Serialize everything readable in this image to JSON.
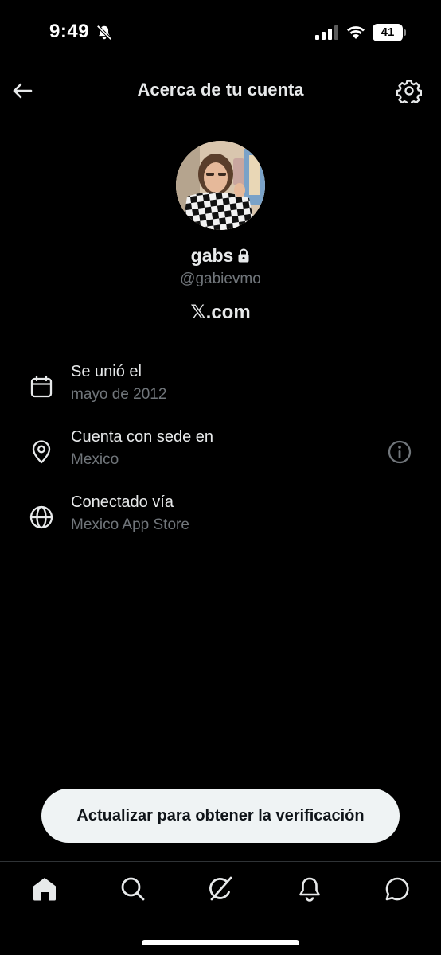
{
  "status_bar": {
    "time": "9:49",
    "battery_level": "41",
    "icons": [
      "bell-muted-icon",
      "signal-icon",
      "wifi-icon",
      "battery-icon"
    ]
  },
  "header": {
    "title": "Acerca de tu cuenta",
    "back_icon": "arrow-left-icon",
    "settings_icon": "gear-icon"
  },
  "profile": {
    "name": "gabs",
    "protected_icon": "lock-icon",
    "handle": "@gabievmo",
    "site": "𝕏.com"
  },
  "info_rows": [
    {
      "icon": "calendar-icon",
      "label": "Se unió el",
      "value": "mayo de 2012"
    },
    {
      "icon": "location-pin-icon",
      "label": "Cuenta con sede en",
      "value": "Mexico",
      "action_icon": "info-icon"
    },
    {
      "icon": "globe-icon",
      "label": "Conectado vía",
      "value": "Mexico App Store"
    }
  ],
  "cta": {
    "label": "Actualizar para obtener la verificación"
  },
  "bottom_nav": {
    "items": [
      "home-icon",
      "search-icon",
      "grok-icon",
      "notifications-icon",
      "messages-icon"
    ],
    "active": "home-icon"
  },
  "colors": {
    "background": "#000000",
    "primary_text": "#e7e9ea",
    "secondary_text": "#71767b",
    "button_bg": "#eff3f4",
    "divider": "#2f3336"
  }
}
